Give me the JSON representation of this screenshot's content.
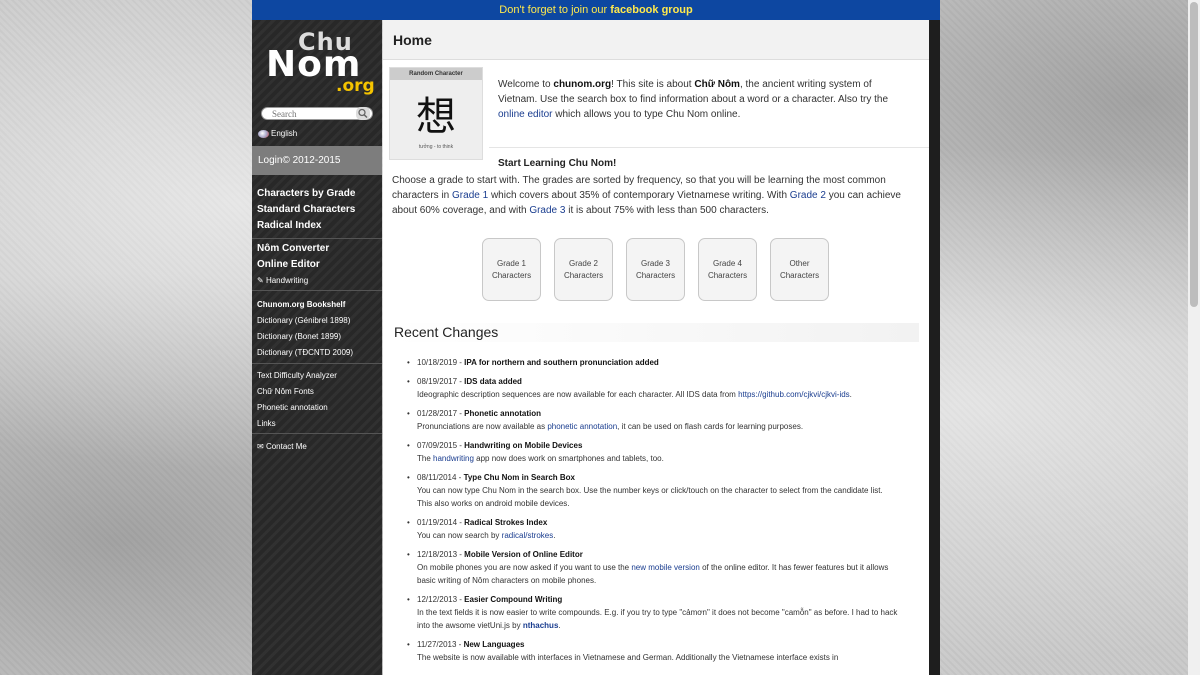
{
  "topbar": {
    "prefix": "Don't forget to join our ",
    "bold": "facebook group"
  },
  "logo": {
    "chu": "Chu",
    "nom": "Nom",
    "org": ".org"
  },
  "search": {
    "placeholder": "Search"
  },
  "language": {
    "label": "English"
  },
  "login": {
    "label": "Login© 2012-2015"
  },
  "nav": {
    "grades": [
      "Characters by Grade",
      "Standard Characters",
      "Radical Index"
    ],
    "tools": [
      "Nôm Converter",
      "Online Editor"
    ],
    "handwriting": "Handwriting",
    "dictionaries": [
      "Chunom.org Bookshelf",
      "Dictionary (Génibrel 1898)",
      "Dictionary (Bonet 1899)",
      "Dictionary (TĐCNTD 2009)"
    ],
    "misc": [
      "Text Difficulty Analyzer",
      "Chữ Nôm Fonts",
      "Phonetic annotation",
      "Links"
    ],
    "contact": "Contact Me"
  },
  "home": {
    "title": "Home",
    "random_char": {
      "header": "Random Character",
      "glyph": "想",
      "meaning": "tưởng - to think"
    },
    "welcome": {
      "p1": "Welcome to ",
      "site": "chunom.org",
      "p2": "! This site is about ",
      "chunom": "Chữ Nôm",
      "p3": ", the ancient writing system of Vietnam. Use the search box to find information about a word or a character. Also try the ",
      "link": "online editor",
      "p4": " which allows you to type Chu Nom online."
    },
    "learn": {
      "title": "Start Learning Chu Nom!",
      "t1": "Choose a grade to start with. The grades are sorted by frequency, so that you will be learning the most common characters in ",
      "g1": "Grade 1",
      "t2": " which covers about 35% of contemporary Vietnamese writing. With ",
      "g2": "Grade 2",
      "t3": " you can achieve about 60% coverage, and with ",
      "g3": "Grade 3",
      "t4": " it is about 75% with less than 500 characters."
    },
    "grade_buttons": [
      {
        "line1": "Grade 1",
        "line2": "Characters"
      },
      {
        "line1": "Grade 2",
        "line2": "Characters"
      },
      {
        "line1": "Grade 3",
        "line2": "Characters"
      },
      {
        "line1": "Grade 4",
        "line2": "Characters"
      },
      {
        "line1": "Other",
        "line2": "Characters"
      }
    ],
    "recent_title": "Recent Changes",
    "changes": [
      {
        "date": "10/18/2019",
        "title": "IPA for northern and southern pronunciation added",
        "body_pre": "",
        "link": "",
        "body_post": ""
      },
      {
        "date": "08/19/2017",
        "title": "IDS data added",
        "body_pre": "Ideographic description sequences are now available for each character. All IDS data from ",
        "link": "https://github.com/cjkvi/cjkvi-ids",
        "body_post": "."
      },
      {
        "date": "01/28/2017",
        "title": "Phonetic annotation",
        "body_pre": "Pronunciations are now available as ",
        "link": "phonetic annotation",
        "body_post": ", it can be used on flash cards for learning purposes."
      },
      {
        "date": "07/09/2015",
        "title": "Handwriting on Mobile Devices",
        "body_pre": "The ",
        "link": "handwriting",
        "body_post": " app now does work on smartphones and tablets, too."
      },
      {
        "date": "08/11/2014",
        "title": "Type Chu Nom in Search Box",
        "body_pre": "You can now type Chu Nom in the search box. Use the number keys or click/touch on the character to select from the candidate list. This also works on android mobile devices.",
        "link": "",
        "body_post": ""
      },
      {
        "date": "01/19/2014",
        "title": "Radical Strokes Index",
        "body_pre": "You can now search by ",
        "link": "radical/strokes",
        "body_post": "."
      },
      {
        "date": "12/18/2013",
        "title": "Mobile Version of Online Editor",
        "body_pre": "On mobile phones you are now asked if you want to use the ",
        "link": "new mobile version",
        "body_post": " of the online editor. It has fewer features but it allows basic writing of Nôm characters on mobile phones."
      },
      {
        "date": "12/12/2013",
        "title": "Easier Compound Writing",
        "body_pre": "In the text fields it is now easier to write compounds. E.g. if you try to type \"cảmơn\" it does not become \"camỗn\" as before. I had to hack into the awsome vietUni.js by ",
        "link": "nthachus",
        "body_post": "."
      },
      {
        "date": "11/27/2013",
        "title": "New Languages",
        "body_pre": "The website is now available with interfaces in Vietnamese and German. Additionally the Vietnamese interface exists in",
        "link": "",
        "body_post": ""
      }
    ]
  }
}
